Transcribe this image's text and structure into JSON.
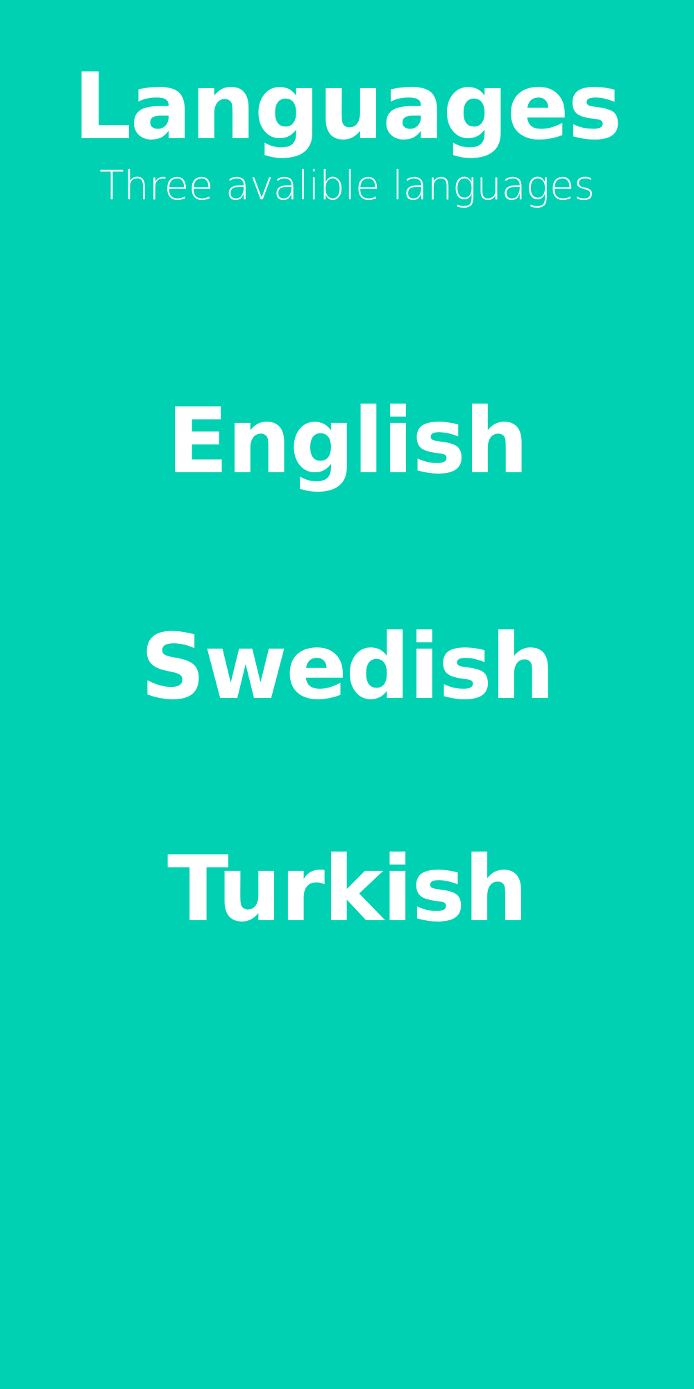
{
  "colors": {
    "background": "#00D1B2",
    "text": "#FFFFFF"
  },
  "header": {
    "title": "Languages",
    "subtitle": "Three avalible languages"
  },
  "languages": [
    {
      "label": "English"
    },
    {
      "label": "Swedish"
    },
    {
      "label": "Turkish"
    }
  ]
}
